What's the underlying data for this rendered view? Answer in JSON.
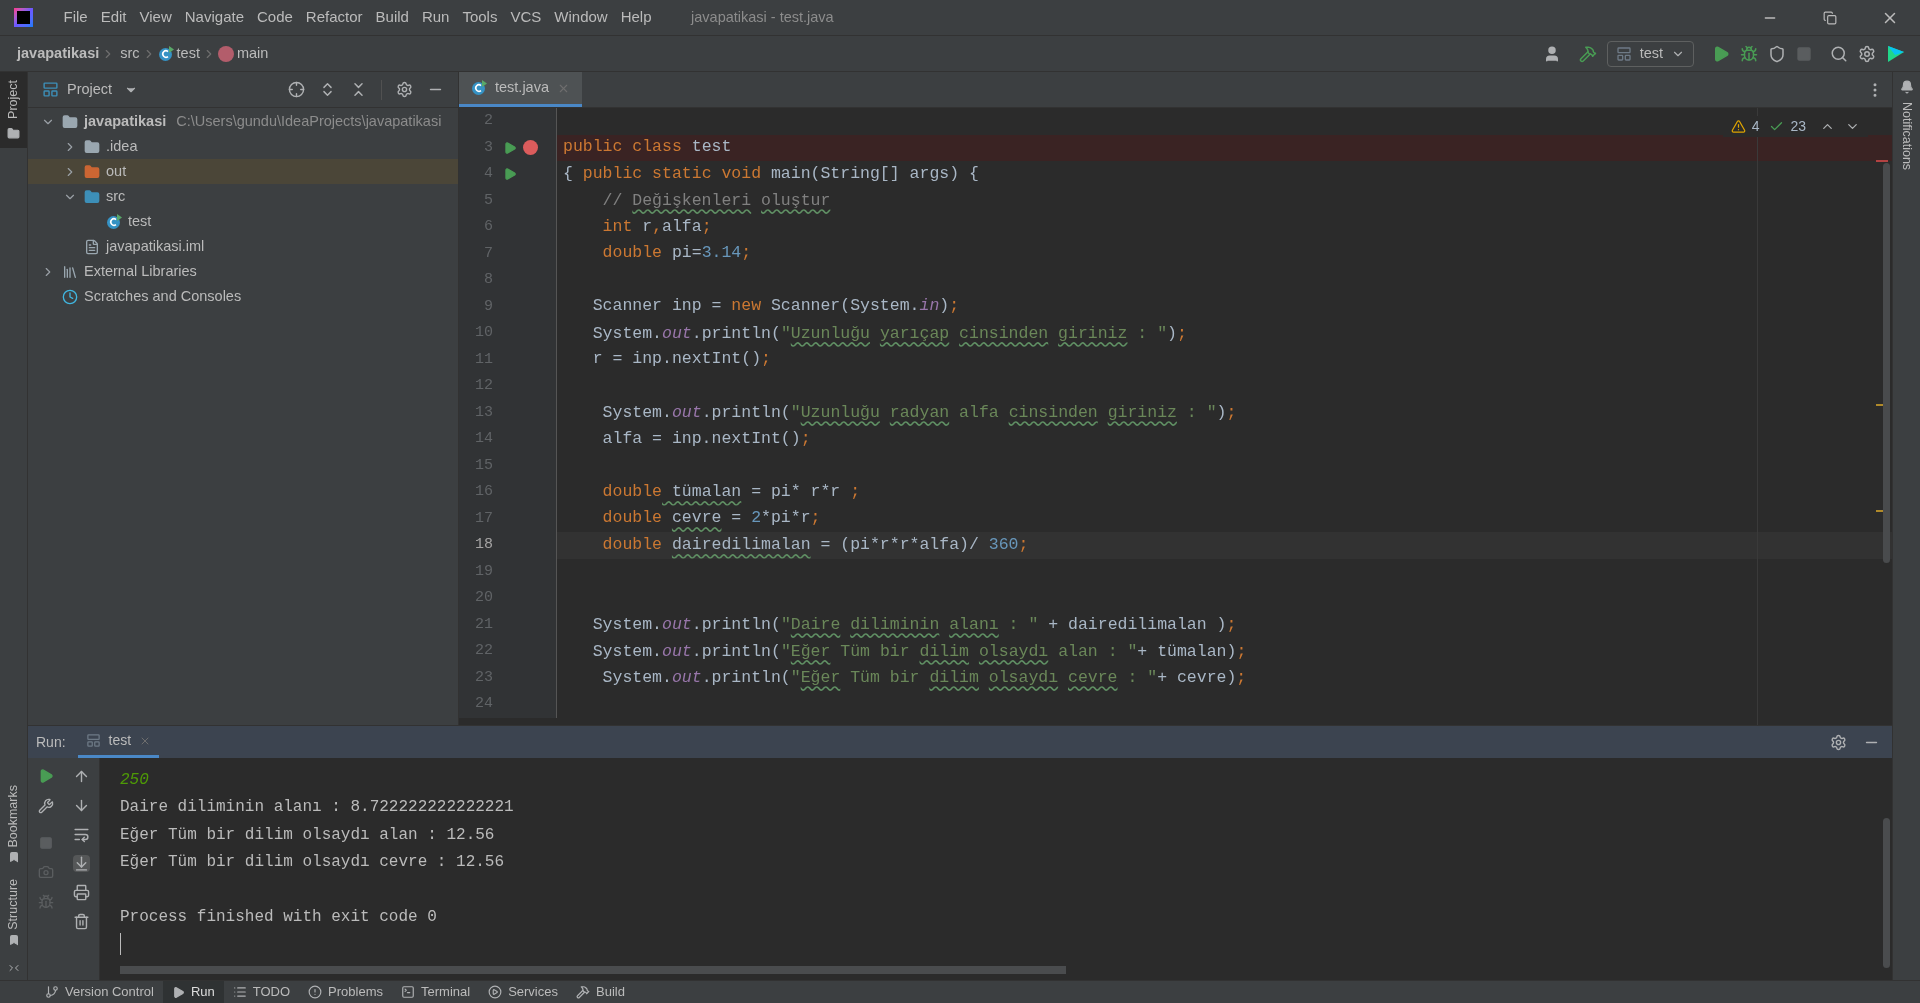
{
  "window": {
    "title": "javapatikasi - test.java"
  },
  "menu": [
    "File",
    "Edit",
    "View",
    "Navigate",
    "Code",
    "Refactor",
    "Build",
    "Run",
    "Tools",
    "VCS",
    "Window",
    "Help"
  ],
  "breadcrumb": [
    {
      "label": "javapatikasi",
      "kind": "project"
    },
    {
      "label": "src",
      "kind": "folder"
    },
    {
      "label": "test",
      "kind": "class"
    },
    {
      "label": "main",
      "kind": "method"
    }
  ],
  "run_config": "test",
  "left_stripe": [
    {
      "label": "Project",
      "selected": true,
      "kind": "top"
    },
    {
      "label": "Bookmarks",
      "selected": false,
      "kind": "bottom"
    },
    {
      "label": "Structure",
      "selected": false,
      "kind": "bottom"
    }
  ],
  "right_stripe": [
    {
      "label": "Notifications"
    }
  ],
  "project_panel": {
    "title": "Project",
    "tree": [
      {
        "label": "javapatikasi",
        "path": "C:\\Users\\gundu\\IdeaProjects\\javapatikasi",
        "kind": "module",
        "expanded": true,
        "selected": false,
        "children": [
          {
            "label": ".idea",
            "kind": "folder",
            "expanded": false,
            "selected": false
          },
          {
            "label": "out",
            "kind": "excluded",
            "expanded": false,
            "selected": true
          },
          {
            "label": "src",
            "kind": "source",
            "expanded": true,
            "selected": false,
            "children": [
              {
                "label": "test",
                "kind": "class",
                "selected": false
              }
            ]
          },
          {
            "label": "javapatikasi.iml",
            "kind": "file",
            "selected": false
          }
        ]
      },
      {
        "label": "External Libraries",
        "kind": "library",
        "expanded": false,
        "selected": false
      },
      {
        "label": "Scratches and Consoles",
        "kind": "scratch",
        "selected": false
      }
    ]
  },
  "editor_tabs": [
    {
      "label": "test.java",
      "selected": true
    }
  ],
  "inspections": {
    "warnings": "4",
    "typos": "23"
  },
  "code": [
    {
      "n": "2"
    },
    {
      "n": "3",
      "run": true,
      "breakpoint": true,
      "tokens": [
        {
          "kind": "kw",
          "text": "public class "
        },
        {
          "kind": "p",
          "text": "test"
        }
      ]
    },
    {
      "n": "4",
      "run": true,
      "tokens": [
        {
          "kind": "p",
          "text": "{ "
        },
        {
          "kind": "kw",
          "text": "public static void "
        },
        {
          "kind": "p",
          "text": "main(String[] args) {"
        }
      ]
    },
    {
      "n": "5",
      "tokens": [
        {
          "kind": "c",
          "text": "    // "
        },
        {
          "kind": "c",
          "text": "Değişkenleri",
          "typo": true,
          "space": true
        },
        {
          "kind": "c",
          "text": "oluştur",
          "typo": true
        }
      ]
    },
    {
      "n": "6",
      "tokens": [
        {
          "kind": "kw",
          "text": "    int"
        },
        {
          "kind": "p",
          "text": " r"
        },
        {
          "kind": "kw",
          "text": ","
        },
        {
          "kind": "p",
          "text": "alfa"
        },
        {
          "kind": "kw",
          "text": ";"
        }
      ]
    },
    {
      "n": "7",
      "tokens": [
        {
          "kind": "kw",
          "text": "    double"
        },
        {
          "kind": "p",
          "text": " pi="
        },
        {
          "kind": "n",
          "text": "3.14"
        },
        {
          "kind": "kw",
          "text": ";"
        }
      ]
    },
    {
      "n": "8"
    },
    {
      "n": "9",
      "tokens": [
        {
          "kind": "p",
          "text": "   Scanner inp = "
        },
        {
          "kind": "kw",
          "text": "new"
        },
        {
          "kind": "p",
          "text": " Scanner(System."
        },
        {
          "kind": "f",
          "text": "in"
        },
        {
          "kind": "p",
          "text": ")"
        },
        {
          "kind": "kw",
          "text": ";"
        }
      ]
    },
    {
      "n": "10",
      "tokens": [
        {
          "kind": "p",
          "text": "   System."
        },
        {
          "kind": "f",
          "text": "out"
        },
        {
          "kind": "p",
          "text": ".println("
        },
        {
          "kind": "s",
          "text": "\""
        },
        {
          "kind": "s",
          "text": "Uzunluğu",
          "typo": true,
          "space": true
        },
        {
          "kind": "s",
          "text": "yarıçap",
          "typo": true,
          "space": true
        },
        {
          "kind": "s",
          "text": "cinsinden",
          "typo": true,
          "space": true
        },
        {
          "kind": "s",
          "text": "giriniz",
          "typo": true
        },
        {
          "kind": "s",
          "text": " : \""
        },
        {
          "kind": "p",
          "text": ")"
        },
        {
          "kind": "kw",
          "text": ";"
        }
      ]
    },
    {
      "n": "11",
      "tokens": [
        {
          "kind": "p",
          "text": "   r = inp.nextInt()"
        },
        {
          "kind": "kw",
          "text": ";"
        }
      ]
    },
    {
      "n": "12"
    },
    {
      "n": "13",
      "tokens": [
        {
          "kind": "p",
          "text": "    System."
        },
        {
          "kind": "f",
          "text": "out"
        },
        {
          "kind": "p",
          "text": ".println("
        },
        {
          "kind": "s",
          "text": "\""
        },
        {
          "kind": "s",
          "text": "Uzunluğu",
          "typo": true,
          "space": true
        },
        {
          "kind": "s",
          "text": "radyan",
          "typo": true
        },
        {
          "kind": "s",
          "text": " alfa "
        },
        {
          "kind": "s",
          "text": "cinsinden",
          "typo": true,
          "space": true
        },
        {
          "kind": "s",
          "text": "giriniz",
          "typo": true
        },
        {
          "kind": "s",
          "text": " : \""
        },
        {
          "kind": "p",
          "text": ")"
        },
        {
          "kind": "kw",
          "text": ";"
        }
      ]
    },
    {
      "n": "14",
      "tokens": [
        {
          "kind": "p",
          "text": "    alfa = inp.nextInt()"
        },
        {
          "kind": "kw",
          "text": ";"
        }
      ]
    },
    {
      "n": "15"
    },
    {
      "n": "16",
      "tokens": [
        {
          "kind": "kw",
          "text": "    double"
        },
        {
          "kind": "p",
          "text": " tümalan",
          "typo": true
        },
        {
          "kind": "p",
          "text": " = pi* r*r "
        },
        {
          "kind": "kw",
          "text": ";"
        }
      ]
    },
    {
      "n": "17",
      "tokens": [
        {
          "kind": "kw",
          "text": "    double "
        },
        {
          "kind": "p",
          "text": "cevre",
          "typo": true
        },
        {
          "kind": "p",
          "text": " = "
        },
        {
          "kind": "n",
          "text": "2"
        },
        {
          "kind": "p",
          "text": "*pi*r"
        },
        {
          "kind": "kw",
          "text": ";"
        }
      ]
    },
    {
      "n": "18",
      "current": true,
      "tokens": [
        {
          "kind": "kw",
          "text": "    double "
        },
        {
          "kind": "p",
          "text": "dairedilimalan",
          "typo": true
        },
        {
          "kind": "p",
          "text": " = (pi*r*r*alfa)/ "
        },
        {
          "kind": "n",
          "text": "360"
        },
        {
          "kind": "kw",
          "text": ";"
        }
      ]
    },
    {
      "n": "19"
    },
    {
      "n": "20"
    },
    {
      "n": "21",
      "tokens": [
        {
          "kind": "p",
          "text": "   System."
        },
        {
          "kind": "f",
          "text": "out"
        },
        {
          "kind": "p",
          "text": ".println("
        },
        {
          "kind": "s",
          "text": "\""
        },
        {
          "kind": "s",
          "text": "Daire",
          "typo": true,
          "space": true
        },
        {
          "kind": "s",
          "text": "diliminin",
          "typo": true,
          "space": true
        },
        {
          "kind": "s",
          "text": "alanı",
          "typo": true
        },
        {
          "kind": "s",
          "text": " : \""
        },
        {
          "kind": "p",
          "text": " + dairedilimalan )"
        },
        {
          "kind": "kw",
          "text": ";"
        }
      ]
    },
    {
      "n": "22",
      "tokens": [
        {
          "kind": "p",
          "text": "   System."
        },
        {
          "kind": "f",
          "text": "out"
        },
        {
          "kind": "p",
          "text": ".println("
        },
        {
          "kind": "s",
          "text": "\""
        },
        {
          "kind": "s",
          "text": "Eğer",
          "typo": true
        },
        {
          "kind": "s",
          "text": " Tüm bir "
        },
        {
          "kind": "s",
          "text": "dilim",
          "typo": true,
          "space": true
        },
        {
          "kind": "s",
          "text": "olsaydı",
          "typo": true
        },
        {
          "kind": "s",
          "text": " alan : \""
        },
        {
          "kind": "p",
          "text": "+ tümalan)"
        },
        {
          "kind": "kw",
          "text": ";"
        }
      ]
    },
    {
      "n": "23",
      "tokens": [
        {
          "kind": "p",
          "text": "    System."
        },
        {
          "kind": "f",
          "text": "out"
        },
        {
          "kind": "p",
          "text": ".println("
        },
        {
          "kind": "s",
          "text": "\""
        },
        {
          "kind": "s",
          "text": "Eğer",
          "typo": true
        },
        {
          "kind": "s",
          "text": " Tüm bir "
        },
        {
          "kind": "s",
          "text": "dilim",
          "typo": true,
          "space": true
        },
        {
          "kind": "s",
          "text": "olsaydı",
          "typo": true,
          "space": true
        },
        {
          "kind": "s",
          "text": "cevre",
          "typo": true
        },
        {
          "kind": "s",
          "text": " : \""
        },
        {
          "kind": "p",
          "text": "+ cevre)"
        },
        {
          "kind": "kw",
          "text": ";"
        }
      ]
    },
    {
      "n": "24"
    }
  ],
  "run_panel": {
    "title": "Run:",
    "tabs": [
      {
        "label": "test",
        "selected": true
      }
    ],
    "output": [
      {
        "text": "250",
        "kind": "input"
      },
      {
        "text": "Daire diliminin alanı : 8.722222222222221",
        "kind": "out"
      },
      {
        "text": "Eğer Tüm bir dilim olsaydı alan : 12.56",
        "kind": "out"
      },
      {
        "text": "Eğer Tüm bir dilim olsaydı cevre : 12.56",
        "kind": "out"
      },
      {
        "kind": "blank"
      },
      {
        "text": "Process finished with exit code 0",
        "kind": "out"
      }
    ]
  },
  "bottom_tabs": [
    {
      "label": "Version Control",
      "kind": "vcs",
      "selected": false
    },
    {
      "label": "Run",
      "kind": "run",
      "selected": true
    },
    {
      "label": "TODO",
      "kind": "todo",
      "selected": false
    },
    {
      "label": "Problems",
      "kind": "problems",
      "selected": false
    },
    {
      "label": "Terminal",
      "kind": "terminal",
      "selected": false
    },
    {
      "label": "Services",
      "kind": "services",
      "selected": false
    },
    {
      "label": "Build",
      "kind": "build",
      "selected": false
    }
  ]
}
